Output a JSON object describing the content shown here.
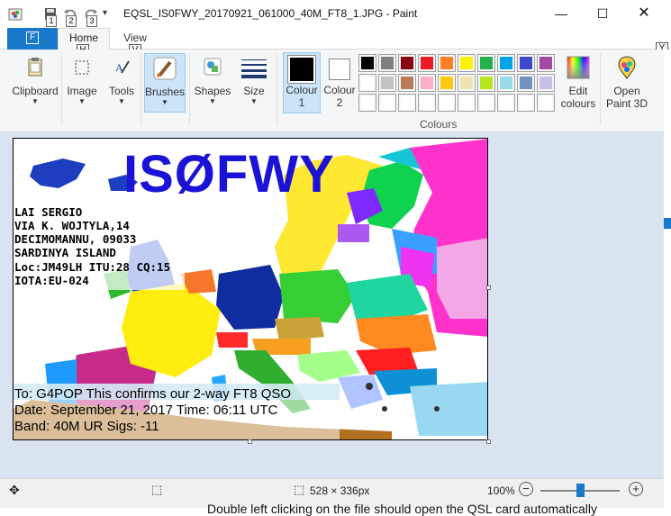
{
  "window": {
    "title": "EQSL_IS0FWY_20170921_061000_40M_FT8_1.JPG - Paint",
    "quick_access_keys": [
      "1",
      "2",
      "3"
    ]
  },
  "tabs": {
    "file": "F",
    "home": "Home",
    "view": "View",
    "key_home": "H",
    "key_view": "V",
    "key_help": "Y",
    "help": "?"
  },
  "ribbon": {
    "clipboard": "Clipboard",
    "image": "Image",
    "tools": "Tools",
    "brushes": "Brushes",
    "shapes": "Shapes",
    "size": "Size",
    "colour1": "Colour\n1",
    "colour1_a": "Colour",
    "colour1_b": "1",
    "colour2_a": "Colour",
    "colour2_b": "2",
    "edit_a": "Edit",
    "edit_b": "colours",
    "paint3d_a": "Open",
    "paint3d_b": "Paint 3D",
    "colours_group": "Colours"
  },
  "palette": {
    "row1": [
      "#000000",
      "#7f7f7f",
      "#880015",
      "#ed1c24",
      "#ff7f27",
      "#fff200",
      "#22b14c",
      "#00a2e8",
      "#3f48cc",
      "#a349a4"
    ],
    "row2": [
      "#ffffff",
      "#c3c3c3",
      "#b97a57",
      "#ffaec9",
      "#ffc90e",
      "#efe4b0",
      "#b5e61d",
      "#99d9ea",
      "#7092be",
      "#c8bfe7"
    ],
    "row3": [
      "#ffffff",
      "#ffffff",
      "#ffffff",
      "#ffffff",
      "#ffffff",
      "#ffffff",
      "#ffffff",
      "#ffffff",
      "#ffffff",
      "#ffffff"
    ],
    "colour1": "#000000",
    "colour2": "#ffffff"
  },
  "qsl": {
    "callsign": "ISØFWY",
    "lines": [
      "LAI SERGIO",
      "VIA K. WOJTYLA,14",
      "DECIMOMANNU, 09033",
      "SARDINYA ISLAND",
      "Loc:JM49LH ITU:28 CQ:15",
      "IOTA:EU-024"
    ],
    "to_line": "To: G4POP  This confirms our 2-way FT8 QSO",
    "date_line": "Date: September 21, 2017  Time: 06:11 UTC",
    "band_line": "Band: 40M UR Sigs: -11"
  },
  "status": {
    "dimensions": "528 × 336px",
    "zoom": "100%",
    "zoom_out": "−",
    "zoom_in": "+",
    "zoom_level": 0.5
  },
  "background_text": "Double left clicking on the file should open the QSL card automatically"
}
